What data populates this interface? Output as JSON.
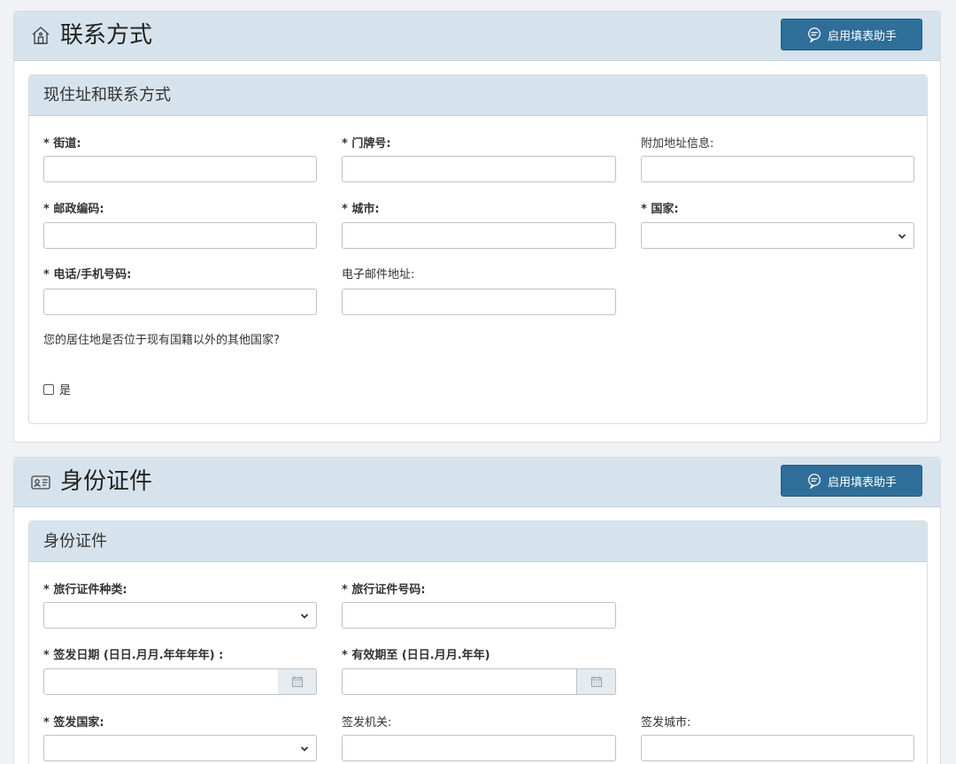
{
  "contact": {
    "title": "联系方式",
    "helper_label": "启用填表助手",
    "sub_title": "现住址和联系方式",
    "street_label": "* 街道:",
    "house_number_label": "* 门牌号:",
    "address_extra_label": "附加地址信息:",
    "postal_label": "* 邮政编码:",
    "city_label": "* 城市:",
    "country_label": "* 国家:",
    "country_value": "",
    "phone_label": "* 电话/手机号码:",
    "email_label": "电子邮件地址:",
    "residence_question": "您的居住地是否位于现有国籍以外的其他国家?",
    "yes_label": "是"
  },
  "identity": {
    "title": "身份证件",
    "helper_label": "启用填表助手",
    "sub_title": "身份证件",
    "doc_type_label": "* 旅行证件种类:",
    "doc_type_value": "",
    "doc_number_label": "* 旅行证件号码:",
    "issue_date_label": "* 签发日期 (日日.月月.年年年年) :",
    "expiry_label": "* 有效期至 (日日.月月.年年)",
    "issue_country_label": "* 签发国家:",
    "issue_country_value": "",
    "authority_label": "签发机关:",
    "issue_city_label": "签发城市:"
  },
  "icons": {
    "home": "home-icon",
    "id_card": "id-card-icon",
    "chat": "chat-bubble-icon",
    "calendar": "calendar-icon",
    "chevron": "chevron-down-icon"
  },
  "colors": {
    "accent": "#2f6e98",
    "header_bg": "#d7e3ec"
  }
}
